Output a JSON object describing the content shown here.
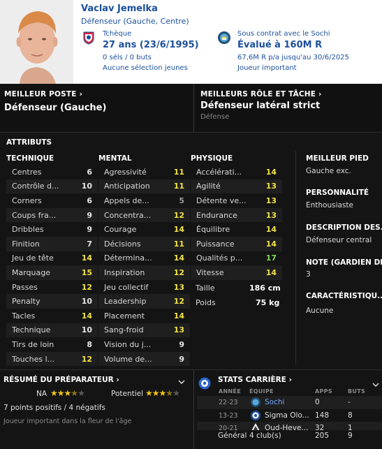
{
  "header": {
    "name": "Vaclav Jemelka",
    "position": "Défenseur (Gauche, Centre)",
    "nationality": "Tchèque",
    "age": "27 ans (23/6/1995)",
    "caps": "0 séls / 0 buts",
    "youth_caps": "Aucune sélection jeunes",
    "contract_status": "Sous contrat avec le Sochi",
    "valuation": "Évalué à 160M R",
    "wage": "67,6M R p/a jusqu'au 30/6/2025",
    "squad_role": "Joueur important",
    "nation_flag_icon": "czech-federation-badge-icon",
    "club_badge_icon": "sochi-badge-icon",
    "text_color": "#1b4f9c"
  },
  "best_position": {
    "title": "MEILLEUR POSTE",
    "value": "Défenseur (Gauche)"
  },
  "best_role": {
    "title": "MEILLEURS RÔLE ET TÂCHE",
    "value": "Défenseur latéral strict",
    "duty": "Défense"
  },
  "attributes": {
    "title": "ATTRIBUTS",
    "technical": {
      "title": "TECHNIQUE",
      "items": [
        {
          "name": "Centres",
          "value": "6"
        },
        {
          "name": "Contrôle d...",
          "value": "10"
        },
        {
          "name": "Corners",
          "value": "6"
        },
        {
          "name": "Coups fra...",
          "value": "9"
        },
        {
          "name": "Dribbles",
          "value": "9"
        },
        {
          "name": "Finition",
          "value": "7"
        },
        {
          "name": "Jeu de tête",
          "value": "14"
        },
        {
          "name": "Marquage",
          "value": "15"
        },
        {
          "name": "Passes",
          "value": "12"
        },
        {
          "name": "Penalty",
          "value": "10"
        },
        {
          "name": "Tacles",
          "value": "14"
        },
        {
          "name": "Technique",
          "value": "10"
        },
        {
          "name": "Tirs de loin",
          "value": "8"
        },
        {
          "name": "Touches l...",
          "value": "12"
        }
      ]
    },
    "mental": {
      "title": "MENTAL",
      "items": [
        {
          "name": "Agressivité",
          "value": "11"
        },
        {
          "name": "Anticipation",
          "value": "11"
        },
        {
          "name": "Appels de...",
          "value": "5"
        },
        {
          "name": "Concentra...",
          "value": "12"
        },
        {
          "name": "Courage",
          "value": "14"
        },
        {
          "name": "Décisions",
          "value": "11"
        },
        {
          "name": "Détermina...",
          "value": "14"
        },
        {
          "name": "Inspiration",
          "value": "12"
        },
        {
          "name": "Jeu collectif",
          "value": "13"
        },
        {
          "name": "Leadership",
          "value": "12"
        },
        {
          "name": "Placement",
          "value": "14"
        },
        {
          "name": "Sang-froid",
          "value": "13"
        },
        {
          "name": "Vision du j...",
          "value": "9"
        },
        {
          "name": "Volume de...",
          "value": "9"
        }
      ]
    },
    "physical": {
      "title": "PHYSIQUE",
      "items": [
        {
          "name": "Accélérati...",
          "value": "14"
        },
        {
          "name": "Agilité",
          "value": "13"
        },
        {
          "name": "Détente ve...",
          "value": "13"
        },
        {
          "name": "Endurance",
          "value": "13"
        },
        {
          "name": "Équilibre",
          "value": "14"
        },
        {
          "name": "Puissance",
          "value": "14"
        },
        {
          "name": "Qualités p...",
          "value": "17"
        },
        {
          "name": "Vitesse",
          "value": "14"
        }
      ],
      "height_label": "Taille",
      "height_value": "186 cm",
      "weight_label": "Poids",
      "weight_value": "75 kg"
    }
  },
  "info": {
    "best_foot_title": "MEILLEUR PIED",
    "best_foot_value": "Gauche exc.",
    "personality_title": "PERSONNALITÉ",
    "personality_value": "Enthousiaste",
    "description_title": "DESCRIPTION DES...",
    "description_value": "Défenseur central",
    "gk_rating_title": "NOTE (GARDIEN DE...",
    "gk_rating_value": "3",
    "traits_title": "CARACTÉRISTIQU...",
    "traits_value": "Aucune"
  },
  "scout": {
    "title": "RÉSUMÉ DU PRÉPARATEUR",
    "ca_label": "NA",
    "ca_stars": 3.5,
    "pa_label": "Potentiel",
    "pa_stars": 3.5,
    "points": "7 points positifs / 4 négatifs",
    "summary": "Joueur important dans la fleur de l'âge"
  },
  "career": {
    "title": "STATS CARRIÈRE",
    "headers": {
      "year": "ANNÉE",
      "club": "ÉQUIPE",
      "apps": "APPS",
      "goals": "BUTS"
    },
    "rows": [
      {
        "year": "22-23",
        "club": "Sochi",
        "apps": "0",
        "goals": "-",
        "link": true
      },
      {
        "year": "13-23",
        "club": "Sigma Olo...",
        "apps": "148",
        "goals": "8",
        "link": false
      },
      {
        "year": "20-21",
        "club": "Oud-Heve...",
        "apps": "32",
        "goals": "1",
        "link": false
      }
    ],
    "total_label": "Général",
    "total_clubs": "4 club(s)",
    "total_apps": "205",
    "total_goals": "9"
  }
}
